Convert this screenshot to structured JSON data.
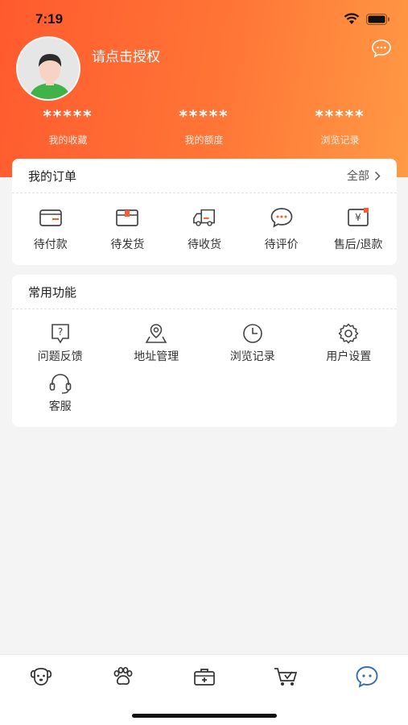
{
  "status_bar": {
    "time": "7:19"
  },
  "header": {
    "auth_prompt": "请点击授权",
    "stats": [
      {
        "value": "*****",
        "label": "我的收藏"
      },
      {
        "value": "*****",
        "label": "我的额度"
      },
      {
        "value": "*****",
        "label": "浏览记录"
      }
    ]
  },
  "orders": {
    "title": "我的订单",
    "more_label": "全部",
    "items": [
      {
        "label": "待付款",
        "icon": "wallet-icon"
      },
      {
        "label": "待发货",
        "icon": "package-icon"
      },
      {
        "label": "待收货",
        "icon": "truck-icon"
      },
      {
        "label": "待评价",
        "icon": "comment-icon"
      },
      {
        "label": "售后/退款",
        "icon": "refund-icon"
      }
    ]
  },
  "functions": {
    "title": "常用功能",
    "items": [
      {
        "label": "问题反馈",
        "icon": "feedback-icon"
      },
      {
        "label": "地址管理",
        "icon": "location-icon"
      },
      {
        "label": "浏览记录",
        "icon": "clock-icon"
      },
      {
        "label": "用户设置",
        "icon": "gear-icon"
      },
      {
        "label": "客服",
        "icon": "headset-icon"
      }
    ]
  },
  "tabbar": {
    "items": [
      {
        "icon": "dog-icon"
      },
      {
        "icon": "paw-icon"
      },
      {
        "icon": "medical-kit-icon"
      },
      {
        "icon": "cart-icon"
      },
      {
        "icon": "chat-icon",
        "active": true
      }
    ]
  },
  "colors": {
    "header_start": "#ff5a2e",
    "header_end": "#ff9a45",
    "active_tab": "#3a6ea5",
    "icon_stroke": "#444444",
    "icon_accent": "#ff5a2e"
  }
}
